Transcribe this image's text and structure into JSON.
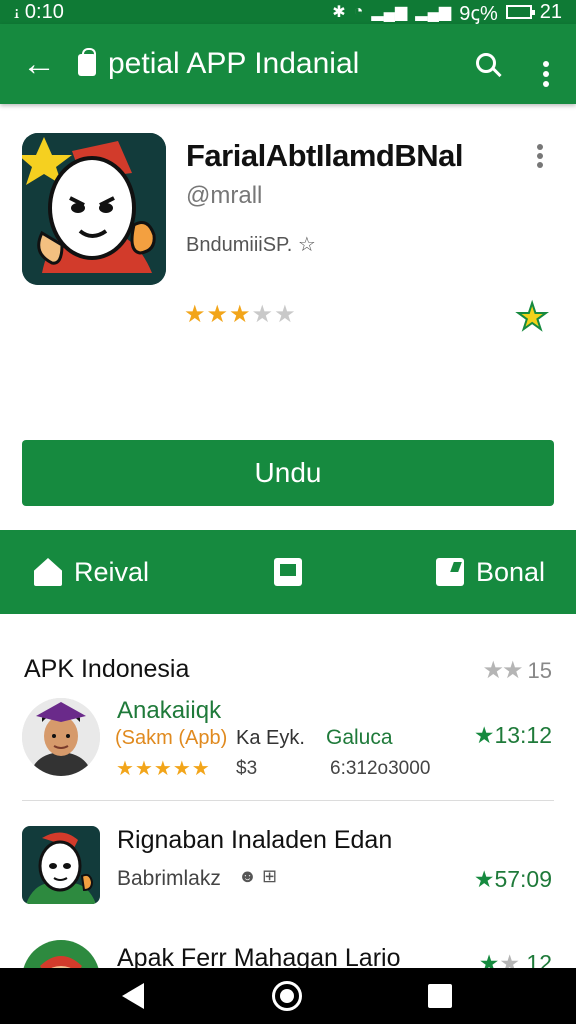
{
  "status_bar": {
    "time": "ꭵ 0:10",
    "battery_text": "9ꞔ%",
    "right_number": "21"
  },
  "app_bar": {
    "title": "petial APP Indanial",
    "icons": [
      "back-arrow-icon",
      "bag-icon",
      "search-icon",
      "more-vert-icon"
    ]
  },
  "app": {
    "name": "FarialAbtIlamdBNal",
    "developer": "@mrall",
    "meta": "Bndumiii⁠SP. ☆",
    "rating": 3,
    "rating_max": 5,
    "accent": "#168a3f"
  },
  "install_button": {
    "label": "Undu"
  },
  "action_strip": [
    {
      "label": "Reival",
      "icon": "home-icon"
    },
    {
      "label": "",
      "icon": "flag-icon"
    },
    {
      "label": "Bonal",
      "icon": "note-icon"
    }
  ],
  "list": {
    "header": "APK Indonesia",
    "header_right": "15",
    "items": [
      {
        "title": "Anakaiiqk",
        "subtitle": "(Sakm (Apb)",
        "mid": "Ka Eyk.",
        "category": "Galuca",
        "price": "$3",
        "size": "6:312o3000",
        "rating": 4.5,
        "time": "13:12"
      },
      {
        "title": "Rignaban Inaladen Edan",
        "developer": "Babrimlakz",
        "time": "57:09"
      },
      {
        "title": "Apak Ferr Mahagan Lario",
        "time": "12"
      }
    ]
  }
}
